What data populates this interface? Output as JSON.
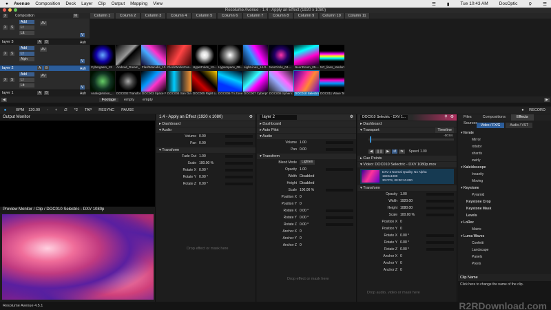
{
  "menubar": {
    "app": "Avenue",
    "items": [
      "Composition",
      "Deck",
      "Layer",
      "Clip",
      "Output",
      "Mapping",
      "View"
    ],
    "time": "Tue 10:43 AM",
    "user": "DocOptic"
  },
  "window_title": "Resolume Avenue - 1.4 - Apply an Effect (1920 x 1080)",
  "composition_label": "Composition",
  "columns": [
    "Column 1",
    "Column 2",
    "Column 3",
    "Column 4",
    "Column 5",
    "Column 6",
    "Column 7",
    "Column 8",
    "Column 9",
    "Column 10",
    "Column 11"
  ],
  "layers": [
    {
      "name": "layer 3",
      "blend_labels": [
        "Add",
        "Lt",
        "Ltt"
      ]
    },
    {
      "name": "layer 2",
      "blend_labels": [
        "Add",
        "Lt",
        "Alph"
      ]
    },
    {
      "name": "layer 1",
      "blend_labels": [
        "Add",
        "Lt",
        "Ltt"
      ]
    }
  ],
  "layer_buttons": {
    "a": "A",
    "b": "B",
    "auto": "Auh",
    "x": "X",
    "s": "S",
    "av": "AV",
    "v": "V"
  },
  "layer2_clips": [
    "Cybergasm_13",
    "Android_Dream_...",
    "FlashMacabs_13...",
    "ClockWorksCus...",
    "HyperFolds_12-...",
    "Hyperspace_08-...",
    "LightLines_14-0...",
    "NeoCircle_04-...",
    "NeonRoom_05-...",
    "NC_lines_random..."
  ],
  "layer1_clips": [
    "AnalogMotion_...",
    "DOC002 Transfor...",
    "DOC003 Space Pa...",
    "DOC004 San Diac...",
    "DOC005 Right Li...",
    "DOC006 Tri Zone...",
    "DOC007 Cyberpn...",
    "DOC008 Spheric...",
    "DOC010 Selectric...",
    "DOC011 Wave Te..."
  ],
  "deck_tabs": [
    "Footage",
    "empty",
    "empty"
  ],
  "transport": {
    "bpm_label": "BPM",
    "bpm": "120.00",
    "minus": "-",
    "plus": "+",
    "half": "/2",
    "double": "*2",
    "tap": "TAP",
    "resync": "RESYNC",
    "pause": "PAUSE",
    "record": "RECORD"
  },
  "output_monitor": "Output Monitor",
  "preview_monitor": "Preview Monitor / Clip / DOC010 Selectric - DXV 1080p",
  "version": "Resolume Avenue 4.5.1",
  "composition_panel": {
    "title": "1.4 - Apply an Effect (1920 x 1080)",
    "dashboard": "Dashboard",
    "audio": "Audio",
    "volume_label": "Volume",
    "volume": "0.00",
    "pan_label": "Pan",
    "pan": "0.00",
    "transform": "Transform",
    "rows": [
      {
        "k": "Fade Out",
        "v": "1.00"
      },
      {
        "k": "Scale",
        "v": "100.00 %"
      },
      {
        "k": "Rotate X",
        "v": "0.00 °"
      },
      {
        "k": "Rotate Y",
        "v": "0.00 °"
      },
      {
        "k": "Rotate Z",
        "v": "0.00 °"
      }
    ],
    "drop_hint": "Drop effect or mask here"
  },
  "layer_panel": {
    "name": "layer 2",
    "dashboard": "Dashboard",
    "autopilot": "Auto Pilot",
    "audio": "Audio",
    "volume_label": "Volume",
    "volume": "1.00",
    "pan_label": "Pan",
    "pan": "0.00",
    "transform": "Transform",
    "blend_label": "Blend Mode",
    "blend": "Lighten",
    "rows": [
      {
        "k": "Opacity",
        "v": "1.00"
      },
      {
        "k": "Width",
        "v": "Disabled"
      },
      {
        "k": "Height",
        "v": "Disabled"
      },
      {
        "k": "Scale",
        "v": "100.00 %"
      },
      {
        "k": "Position X",
        "v": "0"
      },
      {
        "k": "Position Y",
        "v": "0"
      },
      {
        "k": "Rotate X",
        "v": "0.00 °"
      },
      {
        "k": "Rotate Y",
        "v": "0.00 °"
      },
      {
        "k": "Rotate Z",
        "v": "0.00 °"
      },
      {
        "k": "Anchor X",
        "v": "0"
      },
      {
        "k": "Anchor Y",
        "v": "0"
      },
      {
        "k": "Anchor Z",
        "v": "0"
      }
    ],
    "drop_hint": "Drop effect or mask here"
  },
  "clip_panel": {
    "name": "DOC010 Selectric - DXV 1...",
    "dashboard": "Dashboard",
    "transport": "Transport",
    "timeline": "Timeline",
    "time": "-00:04",
    "speed_label": "Speed",
    "speed": "1.00",
    "cue_points": "Cue Points",
    "video_title": "Video: DOC010 Selectric - DXV 1080p.mov",
    "video_info": [
      "DXV 2 Normal Quality, No Alpha",
      "1920x1080",
      "30 FPS, 00:00:10.000"
    ],
    "transform": "Transform",
    "rows": [
      {
        "k": "Opacity",
        "v": "1.00"
      },
      {
        "k": "Width",
        "v": "1920.00"
      },
      {
        "k": "Height",
        "v": "1080.00"
      },
      {
        "k": "Scale",
        "v": "100.00 %"
      },
      {
        "k": "Position X",
        "v": "0"
      },
      {
        "k": "Position Y",
        "v": "0"
      },
      {
        "k": "Rotate X",
        "v": "0.00 °"
      },
      {
        "k": "Rotate Y",
        "v": "0.00 °"
      },
      {
        "k": "Rotate Z",
        "v": "0.00 °"
      },
      {
        "k": "Anchor X",
        "v": "0"
      },
      {
        "k": "Anchor Y",
        "v": "0"
      },
      {
        "k": "Anchor Z",
        "v": "0"
      }
    ],
    "drop_hint": "Drop audio, video or mask here"
  },
  "browser": {
    "tabs": [
      "Files",
      "Compositions",
      "Effects",
      "Sources"
    ],
    "active_tab": "Effects",
    "subtabs": [
      "Video / FX/G",
      "Audio / VST"
    ],
    "groups": [
      {
        "name": "Iterate",
        "items": [
          "Mirror",
          "rotator",
          "shards",
          "swirly"
        ]
      },
      {
        "name": "Kaleidoscope",
        "items": [
          "Insanity",
          "Moving"
        ]
      },
      {
        "name": "Keystone",
        "items": [
          "Pyramid"
        ]
      },
      {
        "name": "Keystone Crop",
        "items": []
      },
      {
        "name": "Keystone Mask",
        "items": []
      },
      {
        "name": "Levels",
        "items": []
      },
      {
        "name": "LoRez",
        "items": [
          "Matrix"
        ]
      },
      {
        "name": "Luma Waves",
        "items": [
          "Confetti",
          "Landscape",
          "Panels",
          "Pixels"
        ]
      }
    ],
    "footer_title": "Clip Name",
    "footer_text": "Click here to change the name of the clip."
  },
  "watermark": "R2RDownload.com",
  "colors": {
    "accent": "#2c5d9a",
    "selected_clip": "#1a79b6",
    "menubar": "#e9e9e9"
  }
}
